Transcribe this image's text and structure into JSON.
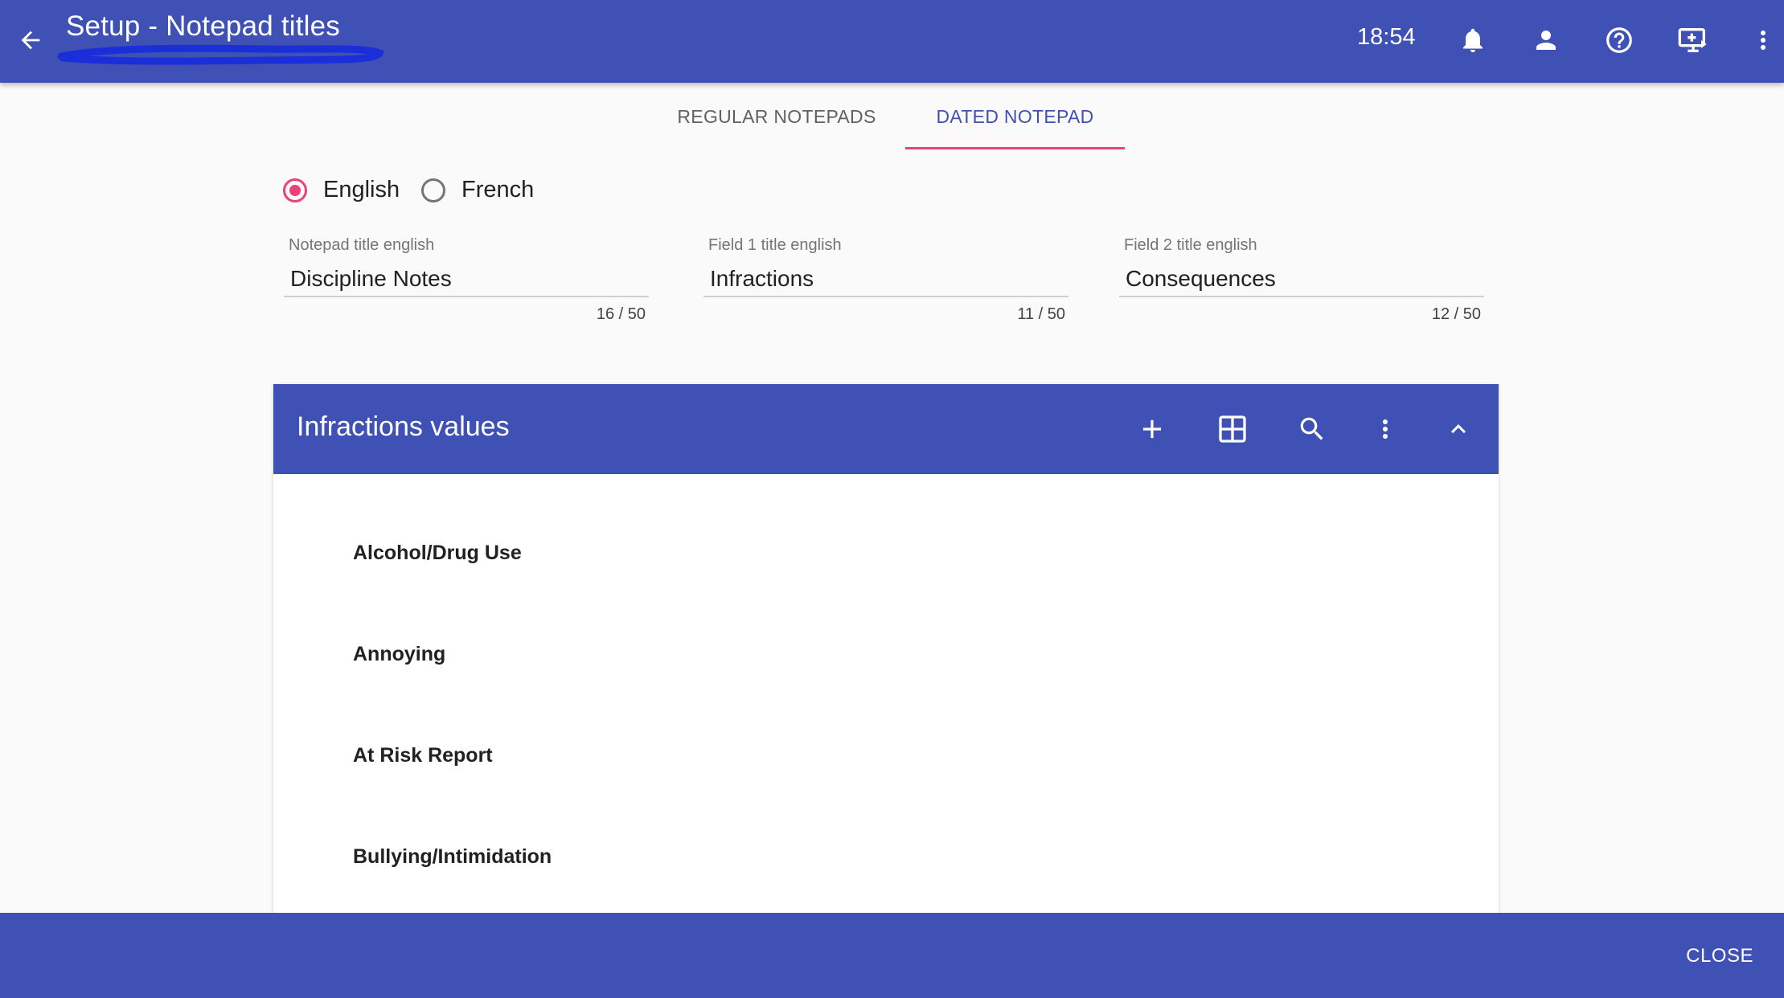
{
  "appbar": {
    "title": "Setup - Notepad titles",
    "time": "18:54",
    "icons": [
      "back-arrow-icon",
      "bell-icon",
      "person-icon",
      "help-circle-icon",
      "monitor-add-icon",
      "more-vert-icon"
    ],
    "background": "#3f51b5"
  },
  "tabs": [
    {
      "label": "REGULAR NOTEPADS",
      "active": false
    },
    {
      "label": "DATED NOTEPAD",
      "active": true
    }
  ],
  "language": {
    "options": [
      {
        "label": "English",
        "selected": true
      },
      {
        "label": "French",
        "selected": false
      }
    ]
  },
  "fields": [
    {
      "label": "Notepad title english",
      "value": "Discipline Notes",
      "counter": "16 / 50"
    },
    {
      "label": "Field 1 title english",
      "value": "Infractions",
      "counter": "11 / 50"
    },
    {
      "label": "Field 2 title english",
      "value": "Consequences",
      "counter": "12 / 50"
    }
  ],
  "values_card": {
    "title": "Infractions values",
    "icons": [
      "add-icon",
      "grid-icon",
      "search-icon",
      "more-vert-icon",
      "chevron-up-icon"
    ],
    "items": [
      "Alcohol/Drug Use",
      "Annoying",
      "At Risk Report",
      "Bullying/Intimidation"
    ]
  },
  "footer": {
    "close_label": "CLOSE"
  },
  "colors": {
    "primary": "#3f51b5",
    "accent": "#ec407a",
    "background": "#fafafa"
  }
}
